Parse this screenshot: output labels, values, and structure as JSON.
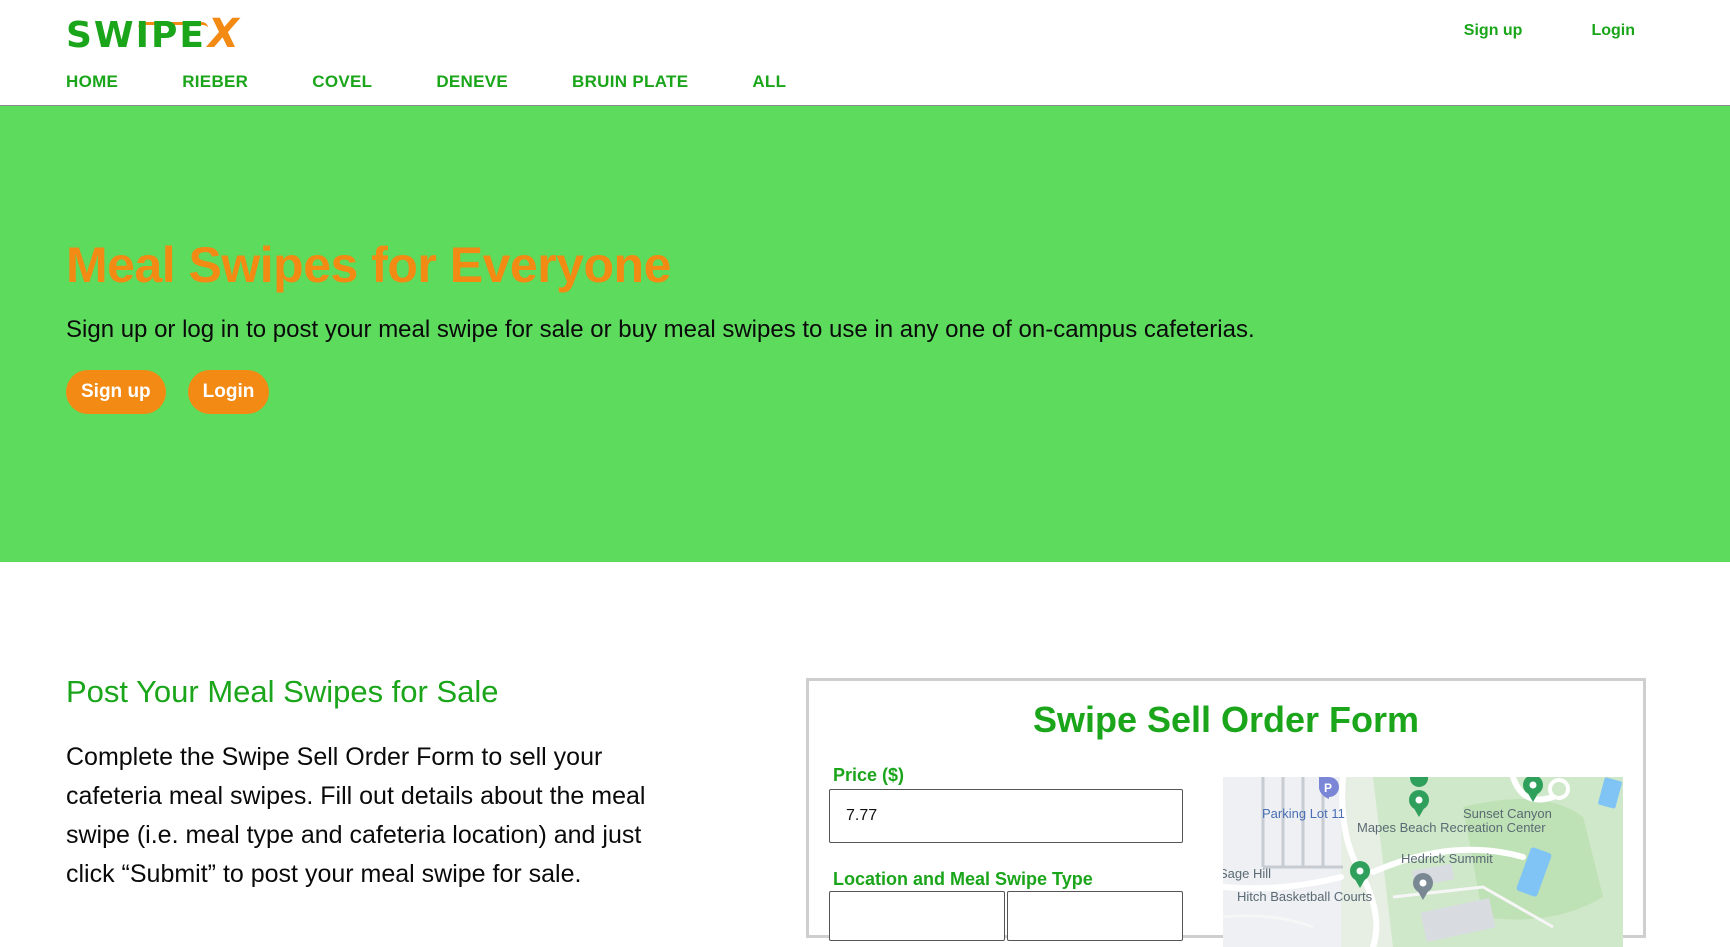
{
  "brand": {
    "name": "SWIPE",
    "x": "X"
  },
  "header": {
    "signup_label": "Sign up",
    "login_label": "Login"
  },
  "nav": {
    "items": [
      {
        "label": "HOME"
      },
      {
        "label": "RIEBER"
      },
      {
        "label": "COVEL"
      },
      {
        "label": "DENEVE"
      },
      {
        "label": "BRUIN PLATE"
      },
      {
        "label": "ALL"
      }
    ]
  },
  "hero": {
    "title": "Meal Swipes for Everyone",
    "subtitle": "Sign up or log in to post your meal swipe for sale or buy meal swipes to use in any one of on-campus cafeterias.",
    "signup_label": "Sign up",
    "login_label": "Login"
  },
  "post": {
    "title": "Post Your Meal Swipes for Sale",
    "description": "Complete the Swipe Sell Order Form to sell your cafeteria meal swipes. Fill out details about the meal swipe (i.e. meal type and cafeteria location) and just click “Submit” to post your meal swipe for sale."
  },
  "form": {
    "title": "Swipe Sell Order Form",
    "price_label": "Price ($)",
    "price_value": "7.77",
    "location_label": "Location and Meal Swipe Type"
  },
  "map": {
    "labels": {
      "parking": "Parking Lot 11",
      "sunset": "Sunset Canyon",
      "recreation": "Mapes Beach Recreation Center",
      "hedrick": "Hedrick Summit",
      "sage": "Sage Hill",
      "hitch": "Hitch Basketball Courts"
    }
  },
  "colors": {
    "brand_green": "#1aa51a",
    "hero_green": "#5cdb5c",
    "accent_orange": "#f28a14"
  }
}
